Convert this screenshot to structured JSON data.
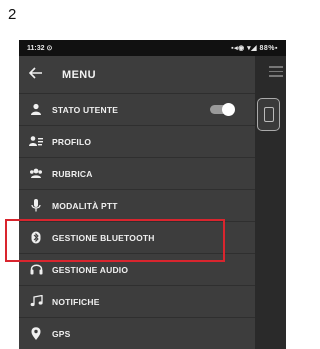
{
  "page": {
    "number": "2"
  },
  "status_bar": {
    "time": "11:32 ⊙",
    "icons": "▪◂◉ ▾◢ 88%▪"
  },
  "menu": {
    "title": "MENU",
    "items": [
      {
        "label": "STATO UTENTE",
        "icon": "person-icon"
      },
      {
        "label": "PROFILO",
        "icon": "profile-icon"
      },
      {
        "label": "RUBRICA",
        "icon": "contacts-icon"
      },
      {
        "label": "MODALITÀ PTT",
        "icon": "microphone-icon"
      },
      {
        "label": "GESTIONE BLUETOOTH",
        "icon": "bluetooth-icon"
      },
      {
        "label": "GESTIONE AUDIO",
        "icon": "headphones-icon"
      },
      {
        "label": "NOTIFICHE",
        "icon": "music-note-icon"
      },
      {
        "label": "GPS",
        "icon": "location-pin-icon"
      }
    ],
    "stato_utente_toggle_on": true
  },
  "highlight": {
    "color": "#d9252e",
    "target": "GESTIONE BLUETOOTH"
  },
  "colors": {
    "menu_bg": "#3d3d3d",
    "status_bg": "#111111",
    "text": "#f0f0f0"
  }
}
